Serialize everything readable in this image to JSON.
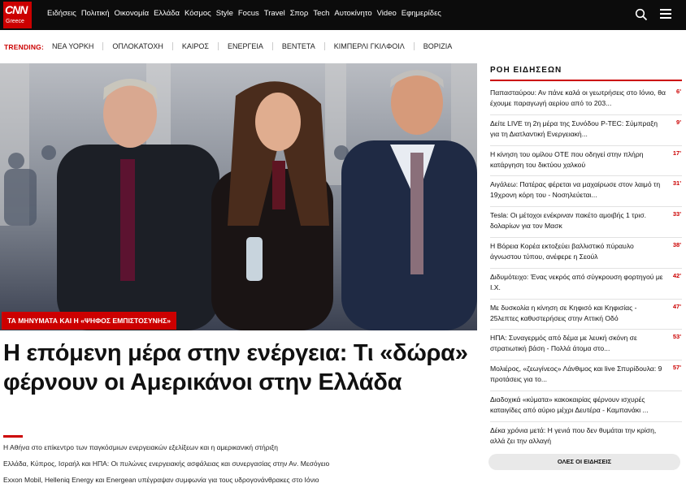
{
  "header": {
    "logo_text": "CNN",
    "logo_sub": "Greece",
    "nav": [
      "Ειδήσεις",
      "Πολιτική",
      "Οικονομία",
      "Ελλάδα",
      "Κόσμος",
      "Style",
      "Focus",
      "Travel",
      "Σπορ",
      "Tech",
      "Αυτοκίνητο",
      "Video",
      "Εφημερίδες"
    ]
  },
  "trending": {
    "label": "TRENDING:",
    "items": [
      "ΝΕΑ ΥΟΡΚΗ",
      "ΟΠΛΟΚΑΤΟΧΗ",
      "ΚΑΙΡΟΣ",
      "ΕΝΕΡΓΕΙΑ",
      "ΒΕΝΤΕΤΑ",
      "ΚΙΜΠΕΡΛΙ ΓΚΙΛΦΟΙΛ",
      "ΒΟΡΙΖΙΑ"
    ]
  },
  "hero": {
    "label": "ΤΑ ΜΗΝΥΜΑΤΑ ΚΑΙ Η «ΨΗΦΟΣ ΕΜΠΙΣΤΟΣΥΝΗΣ»",
    "headline": "Η επόμενη μέρα στην ενέργεια: Τι «δώρα» φέρνουν οι Αμερικάνοι στην Ελλάδα",
    "related": [
      "Η Αθήνα στο επίκεντρο των παγκόσμιων ενεργειακών εξελίξεων και η αμερικανική στήριξη",
      "Ελλάδα, Κύπρος, Ισραήλ και ΗΠΑ: Οι πυλώνες ενεργειακής ασφάλειας και συνεργασίας στην Αν. Μεσόγειο",
      "Exxon Mobil, Helleniq Energy και Energean υπέγραψαν συμφωνία για τους υδρογονάνθρακες στο Ιόνιο"
    ]
  },
  "feed": {
    "title": "ΡΟΗ ΕΙΔΗΣΕΩΝ",
    "items": [
      {
        "text": "Παπασταύρου: Αν πάνε καλά οι γεωτρήσεις στο Ιόνιο, θα έχουμε παραγωγή αερίου από το 203...",
        "time": "6'"
      },
      {
        "text": "Δείτε LIVE τη 2η μέρα της Συνόδου P-TEC: Σύμπραξη για τη Διατλαντική Ενεργειακή...",
        "time": "9'"
      },
      {
        "text": "Η κίνηση του ομίλου ΟΤΕ που οδηγεί στην πλήρη κατάργηση του δικτύου χαλκού",
        "time": "17'"
      },
      {
        "text": "Αιγάλεω: Πατέρας φέρεται να μαχαίρωσε στον λαιμό τη 19χρονη κόρη του - Νοσηλεύεται...",
        "time": "31'"
      },
      {
        "text": "Tesla: Οι μέτοχοι ενέκριναν πακέτο αμοιβής 1 τρισ. δολαρίων για τον Μασκ",
        "time": "33'"
      },
      {
        "text": "Η Βόρεια Κορέα εκτοξεύει βαλλιστικό πύραυλο άγνωστου τύπου, ανέφερε η Σεούλ",
        "time": "38'"
      },
      {
        "text": "Διδυμότειχο: Ένας νεκρός από σύγκρουση φορτηγού με Ι.Χ.",
        "time": "42'"
      },
      {
        "text": "Με δυσκολία η κίνηση σε Κηφισό και Κηφισίας - 25λεπτες καθυστερήσεις στην Αττική Οδό",
        "time": "47'"
      },
      {
        "text": "ΗΠΑ: Συναγερμός από δέμα με λευκή σκόνη σε στρατιωτική βάση - Πολλά άτομα στο...",
        "time": "53'"
      },
      {
        "text": "Μολιέρος, «ζεωγίνεος» Λάνθιμος και live Σπυρίδουλα: 9 προτάσεις για το...",
        "time": "57'"
      },
      {
        "text": "Διαδοχικά «κύματα» κακοκαιρίας φέρνουν ισχυρές καταιγίδες από αύριο μέχρι Δευτέρα - Καμπανάκι ...",
        "time": ""
      },
      {
        "text": "Δέκα χρόνια μετά: Η γενιά που δεν θυμάται την κρίση, αλλά ζει την αλλαγή",
        "time": ""
      }
    ],
    "all_button": "ΟΛΕΣ ΟΙ ΕΙΔΗΣΕΙΣ"
  }
}
